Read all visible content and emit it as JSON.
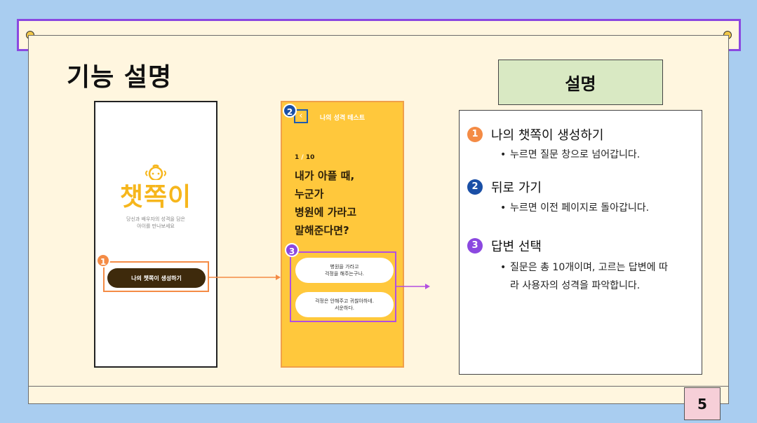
{
  "page_title": "기능 설명",
  "page_number": "5",
  "phone1": {
    "logo": "챗쪽이",
    "subtitle_line1": "당신과 배우자의 성격을 담은",
    "subtitle_line2": "아이를 만나보세요",
    "button_label": "나의 챗쪽이 생성하기"
  },
  "phone2": {
    "header": "나의 성격 테스트",
    "back_icon": "chevron-left-icon",
    "progress_current": "1",
    "progress_sep": " / ",
    "progress_total": "10",
    "question": "내가 아플 때,\n누군가\n병원에 가라고\n말해준다면?",
    "answers": [
      "병원을 가라고\n걱정을 해주는구나.",
      "걱정은 안해주고 귀찮아하네.\n서운하다."
    ]
  },
  "badges": [
    "1",
    "2",
    "3"
  ],
  "description": {
    "title": "설명",
    "items": [
      {
        "num": "1",
        "heading": "나의 챗쪽이 생성하기",
        "bullet": "누르면 질문 창으로 넘어갑니다.",
        "cont": ""
      },
      {
        "num": "2",
        "heading": "뒤로 가기",
        "bullet": "누르면 이전 페이지로 돌아갑니다.",
        "cont": ""
      },
      {
        "num": "3",
        "heading": "답변 선택",
        "bullet": "질문은 총 10개이며, 고르는 답변에 따",
        "cont": "라 사용자의 성격을 파악합니다."
      }
    ]
  },
  "colors": {
    "accent_orange": "#f48b45",
    "accent_blue": "#1a4fa6",
    "accent_purple": "#8b48e0",
    "phone2_bg": "#ffc83c",
    "logo_yellow": "#f6b61c"
  }
}
